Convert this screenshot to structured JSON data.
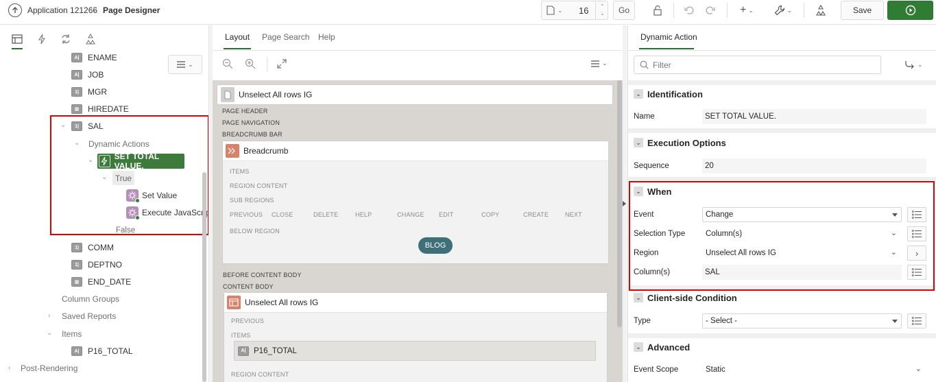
{
  "header": {
    "app_label": "Application 121266",
    "separator": "\\",
    "page_label": "Page Designer",
    "page_number": "16",
    "go_label": "Go",
    "save_label": "Save"
  },
  "left": {
    "tree": {
      "ename": "ENAME",
      "job": "JOB",
      "mgr": "MGR",
      "hiredate": "HIREDATE",
      "sal": "SAL",
      "dynamic_actions": "Dynamic Actions",
      "set_total": "SET TOTAL VALUE.",
      "true_label": "True",
      "set_value": "Set Value",
      "execute_js": "Execute JavaScript Code",
      "false_label": "False",
      "comm": "COMM",
      "deptno": "DEPTNO",
      "end_date": "END_DATE",
      "column_groups": "Column Groups",
      "saved_reports": "Saved Reports",
      "items": "Items",
      "p16_total": "P16_TOTAL",
      "post_rendering": "Post-Rendering"
    }
  },
  "middle": {
    "tabs": [
      "Layout",
      "Page Search",
      "Help"
    ],
    "page_region_title": "Unselect All rows IG",
    "page_header": "PAGE HEADER",
    "page_navigation": "PAGE NAVIGATION",
    "breadcrumb_bar": "BREADCRUMB BAR",
    "breadcrumb_title": "Breadcrumb",
    "bc_items": "ITEMS",
    "bc_region_content": "REGION CONTENT",
    "bc_sub_regions": "SUB REGIONS",
    "bc_buttons": [
      "PREVIOUS",
      "CLOSE",
      "DELETE",
      "HELP",
      "CHANGE",
      "EDIT",
      "COPY",
      "CREATE",
      "NEXT"
    ],
    "bc_below_region": "BELOW REGION",
    "blog_label": "BLOG",
    "before_content_body": "BEFORE CONTENT BODY",
    "content_body": "CONTENT BODY",
    "ig_title": "Unselect All rows IG",
    "ig_previous": "PREVIOUS",
    "ig_items": "ITEMS",
    "ig_item": "P16_TOTAL",
    "ig_region_content": "REGION CONTENT"
  },
  "right": {
    "tab": "Dynamic Action",
    "filter_placeholder": "Filter",
    "identification": {
      "title": "Identification",
      "name_label": "Name",
      "name_value": "SET TOTAL VALUE."
    },
    "execution": {
      "title": "Execution Options",
      "sequence_label": "Sequence",
      "sequence_value": "20"
    },
    "when": {
      "title": "When",
      "event_label": "Event",
      "event_value": "Change",
      "selection_type_label": "Selection Type",
      "selection_type_value": "Column(s)",
      "region_label": "Region",
      "region_value": "Unselect All rows IG",
      "columns_label": "Column(s)",
      "columns_value": "SAL"
    },
    "client_condition": {
      "title": "Client-side Condition",
      "type_label": "Type",
      "type_value": "- Select -"
    },
    "advanced": {
      "title": "Advanced",
      "event_scope_label": "Event Scope",
      "event_scope_value": "Static"
    }
  },
  "colors": {
    "highlight_box": "#e00000",
    "selected_da": "#3d7a3b",
    "go_button": "#2e7d32",
    "blog_button": "#3f6f78",
    "tab_underline": "#2c6b33"
  }
}
